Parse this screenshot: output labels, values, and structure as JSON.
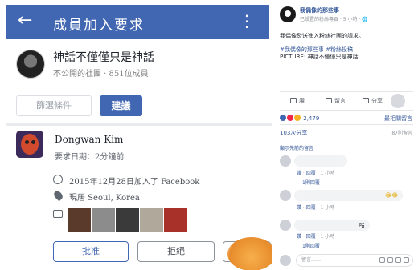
{
  "left": {
    "topbar": {
      "title": "成員加入要求"
    },
    "group": {
      "name": "神話不僅僅只是神話",
      "meta": "不公開的社團 · 851位成員"
    },
    "filters": {
      "filter_label": "篩選條件",
      "suggest_label": "建議"
    },
    "member": {
      "name": "Dongwan Kim",
      "requested": "要求日期：2分鐘前",
      "joined": "2015年12月28日加入了 Facebook",
      "lives": "現居 Seoul, Korea"
    },
    "photo_colors": [
      "#5a3a2a",
      "#8c8c8c",
      "#3a3a3a",
      "#b0a89a",
      "#a8322a"
    ],
    "buttons": {
      "approve_label": "批准",
      "decline_label": "拒絕"
    }
  },
  "right": {
    "page": {
      "name": "我偶像的那些事",
      "sub": "已設置的粉絲專頁 · 5 小時 · 🌐"
    },
    "post": {
      "line1": "我偶像發送進入粉絲社團的請求。",
      "tags": "#我偶像的那些事 #粉絲投稿",
      "picture": "PICTURE: 神話不僅僅只是神話"
    },
    "actions": {
      "like": "讚",
      "comment": "留言",
      "share": "分享"
    },
    "reactions": {
      "count": "2,479",
      "sort": "最相關留言"
    },
    "shares": "103次分享",
    "comment_count": "87則留言",
    "more_comments": "顯示先前的留言",
    "comment_meta": {
      "like": "讚",
      "reply": "回覆",
      "time": "1 小時"
    },
    "reply_count": "1則回覆",
    "comments": {
      "c3_tail": "哈",
      "c2_emoji": "😂😂"
    },
    "composer_placeholder": "留言……"
  }
}
